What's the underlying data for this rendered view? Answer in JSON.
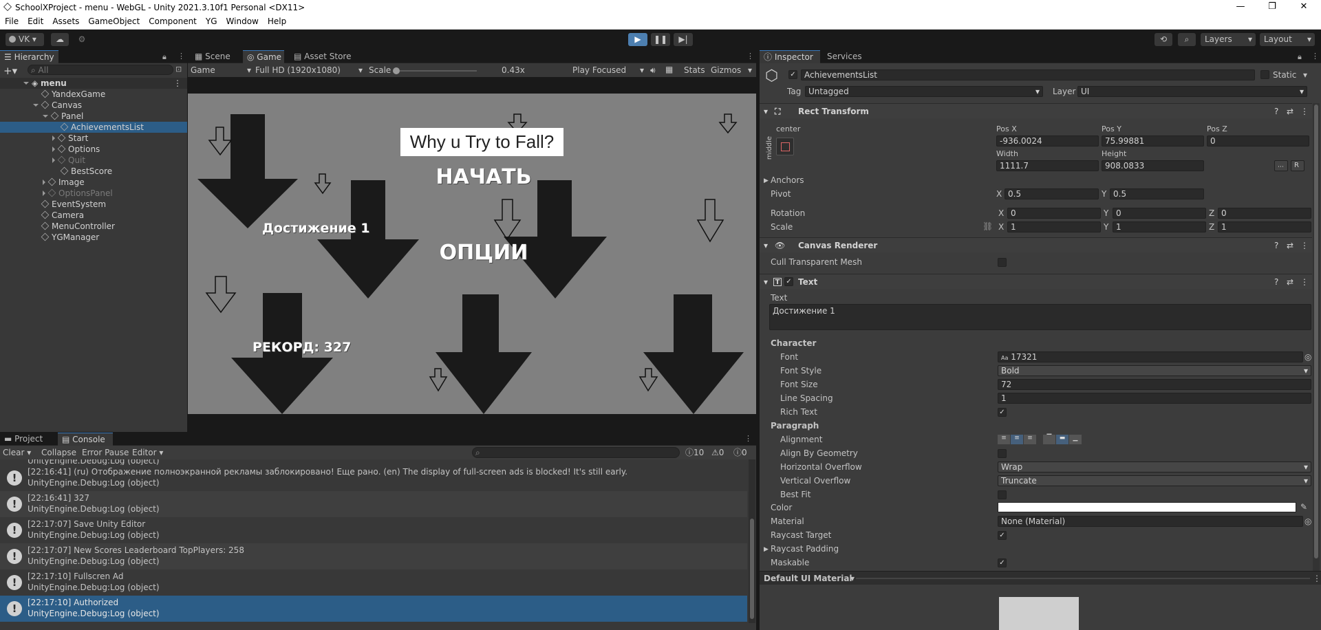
{
  "window": {
    "title": "SchoolXProject - menu - WebGL - Unity 2021.3.10f1 Personal <DX11>",
    "controls": {
      "minimize": "—",
      "maximize": "❐",
      "close": "✕"
    }
  },
  "menu": [
    "File",
    "Edit",
    "Assets",
    "GameObject",
    "Component",
    "YG",
    "Window",
    "Help"
  ],
  "toolbar": {
    "account": "VK",
    "layers": "Layers",
    "layout": "Layout"
  },
  "hierarchy": {
    "tab": "Hierarchy",
    "search_placeholder": "All",
    "items": [
      {
        "label": "menu",
        "depth": 0
      },
      {
        "label": "YandexGame",
        "depth": 1
      },
      {
        "label": "Canvas",
        "depth": 1
      },
      {
        "label": "Panel",
        "depth": 2
      },
      {
        "label": "AchievementsList",
        "depth": 3
      },
      {
        "label": "Start",
        "depth": 3
      },
      {
        "label": "Options",
        "depth": 3
      },
      {
        "label": "Quit",
        "depth": 3
      },
      {
        "label": "BestScore",
        "depth": 3
      },
      {
        "label": "Image",
        "depth": 2
      },
      {
        "label": "OptionsPanel",
        "depth": 2
      },
      {
        "label": "EventSystem",
        "depth": 1
      },
      {
        "label": "Camera",
        "depth": 1
      },
      {
        "label": "MenuController",
        "depth": 1
      },
      {
        "label": "YGManager",
        "depth": 1
      }
    ]
  },
  "game_view": {
    "tabs": [
      "Scene",
      "Game",
      "Asset Store"
    ],
    "display": "Game",
    "resolution": "Full HD (1920x1080)",
    "scale_label": "Scale",
    "scale_value": "0.43x",
    "play_mode": "Play Focused",
    "stats": "Stats",
    "gizmos": "Gizmos",
    "title": "Why u Try to Fall?",
    "start": "НАЧАТЬ",
    "options": "ОПЦИИ",
    "achievement": "Достижение 1",
    "record": "РЕКОРД: 327"
  },
  "console": {
    "tabs": [
      "Project",
      "Console"
    ],
    "buttons": {
      "clear": "Clear",
      "collapse": "Collapse",
      "error_pause": "Error Pause",
      "editor": "Editor"
    },
    "counts": {
      "logs": "10",
      "warnings": "0",
      "errors": "0"
    },
    "partial_top": "UnityEngine.Debug:Log (object)",
    "logs": [
      {
        "msg": "[22:16:41] (ru) Отображение полноэкранной рекламы заблокировано! Еще рано.  (en) The display of full-screen ads is blocked! It's still early.",
        "src": "UnityEngine.Debug:Log (object)"
      },
      {
        "msg": "[22:16:41] 327",
        "src": "UnityEngine.Debug:Log (object)"
      },
      {
        "msg": "[22:17:07] Save Unity Editor",
        "src": "UnityEngine.Debug:Log (object)"
      },
      {
        "msg": "[22:17:07] New Scores Leaderboard TopPlayers: 258",
        "src": "UnityEngine.Debug:Log (object)"
      },
      {
        "msg": "[22:17:10] Fullscren Ad",
        "src": "UnityEngine.Debug:Log (object)"
      },
      {
        "msg": "[22:17:10] Authorized",
        "src": "UnityEngine.Debug:Log (object)"
      }
    ]
  },
  "inspector": {
    "tabs": [
      "Inspector",
      "Services"
    ],
    "object_name": "AchievementsList",
    "static": "Static",
    "tag_label": "Tag",
    "tag_value": "Untagged",
    "layer_label": "Layer",
    "layer_value": "UI",
    "rect": {
      "title": "Rect Transform",
      "anchor_h": "center",
      "anchor_v": "middle",
      "posx_label": "Pos X",
      "posx": "-936.0024",
      "posy_label": "Pos Y",
      "posy": "75.99881",
      "posz_label": "Pos Z",
      "posz": "0",
      "width_label": "Width",
      "width": "1111.7",
      "height_label": "Height",
      "height": "908.0833",
      "anchors": "Anchors",
      "pivot": "Pivot",
      "pivot_x": "0.5",
      "pivot_y": "0.5",
      "rotation": "Rotation",
      "rot_x": "0",
      "rot_y": "0",
      "rot_z": "0",
      "scale": "Scale",
      "scale_x": "1",
      "scale_y": "1",
      "scale_z": "1",
      "x": "X",
      "y": "Y",
      "z": "Z",
      "r_btn": "R"
    },
    "canvas_renderer": {
      "title": "Canvas Renderer",
      "cull": "Cull Transparent Mesh"
    },
    "text": {
      "title": "Text",
      "text_label": "Text",
      "text_value": "Достижение 1",
      "character": "Character",
      "font_label": "Font",
      "font_value": "17321",
      "font_prefix": "Aa",
      "font_style_label": "Font Style",
      "font_style": "Bold",
      "font_size_label": "Font Size",
      "font_size": "72",
      "line_spacing_label": "Line Spacing",
      "line_spacing": "1",
      "rich_text": "Rich Text",
      "paragraph": "Paragraph",
      "alignment": "Alignment",
      "align_geom": "Align By Geometry",
      "h_overflow_label": "Horizontal Overflow",
      "h_overflow": "Wrap",
      "v_overflow_label": "Vertical Overflow",
      "v_overflow": "Truncate",
      "best_fit": "Best Fit",
      "color": "Color",
      "material_label": "Material",
      "material": "None (Material)",
      "raycast_target": "Raycast Target",
      "raycast_padding": "Raycast Padding",
      "maskable": "Maskable"
    },
    "footer": "Default UI Material"
  },
  "colors": {
    "accent": "#2c5d87",
    "game_bg": "#808080",
    "arrow": "#1a1a1a"
  }
}
